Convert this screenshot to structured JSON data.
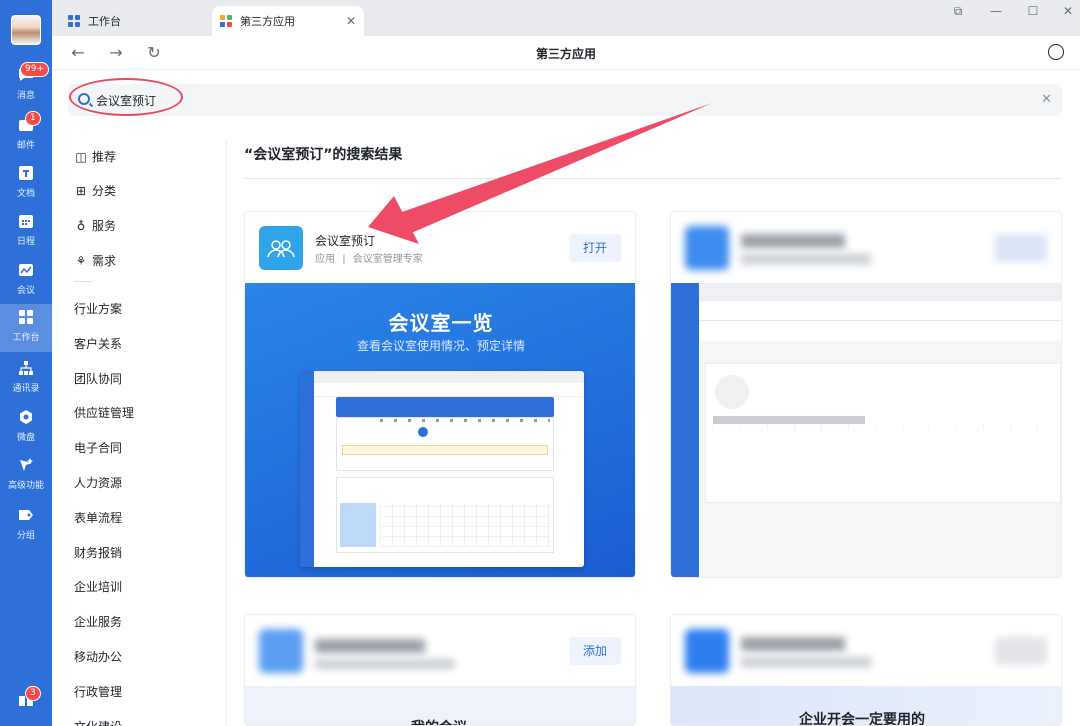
{
  "rail": {
    "items": [
      {
        "label": "消息",
        "badge": "99+"
      },
      {
        "label": "邮件",
        "badge": "1"
      },
      {
        "label": "文档"
      },
      {
        "label": "日程"
      },
      {
        "label": "会议"
      },
      {
        "label": "工作台"
      },
      {
        "label": "通讯录"
      },
      {
        "label": "微盘"
      },
      {
        "label": "高级功能"
      },
      {
        "label": "分组"
      }
    ],
    "bottom_badge": "3"
  },
  "tabs": [
    {
      "label": "工作台"
    },
    {
      "label": "第三方应用"
    }
  ],
  "nav": {
    "title": "第三方应用"
  },
  "search": {
    "value": "会议室预订"
  },
  "sidenav": {
    "primary": [
      {
        "label": "推荐",
        "icon": "recommend-icon"
      },
      {
        "label": "分类",
        "icon": "category-icon"
      },
      {
        "label": "服务",
        "icon": "service-icon"
      },
      {
        "label": "需求",
        "icon": "demand-icon"
      }
    ],
    "categories": [
      "行业方案",
      "客户关系",
      "团队协同",
      "供应链管理",
      "电子合同",
      "人力资源",
      "表单流程",
      "财务报销",
      "企业培训",
      "企业服务",
      "移动办公",
      "行政管理",
      "文化建设"
    ]
  },
  "results": {
    "title": "“会议室预订”的搜索结果",
    "card1": {
      "name": "会议室预订",
      "meta_type": "应用",
      "meta_sep": "|",
      "meta_desc": "会议室管理专家",
      "button": "打开",
      "banner_title": "会议室一览",
      "banner_subtitle": "查看会议室使用情况、预定详情"
    },
    "card3": {
      "button": "添加"
    },
    "card4": {
      "banner_text": "企业开会一定要用的"
    },
    "card_partial": {
      "text": "我的会议"
    }
  },
  "colors": {
    "brand": "#2f6fd8",
    "annotation": "#e84a5f"
  }
}
